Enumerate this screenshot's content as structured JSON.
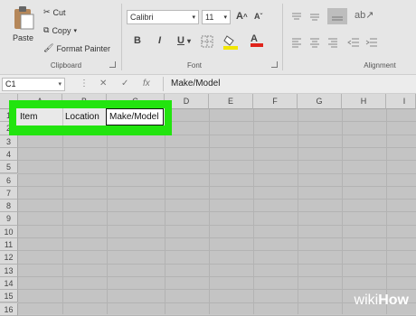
{
  "ribbon": {
    "clipboard": {
      "paste_label": "Paste",
      "cut_label": "Cut",
      "copy_label": "Copy",
      "format_painter_label": "Format Painter",
      "group_label": "Clipboard"
    },
    "font": {
      "font_name": "Calibri",
      "font_size": "11",
      "grow_glyph": "A",
      "shrink_glyph": "A",
      "bold": "B",
      "italic": "I",
      "underline": "U",
      "font_color_glyph": "A",
      "group_label": "Font",
      "highlight_color": "#f2e600",
      "font_color": "#e0241b"
    },
    "alignment": {
      "group_label": "Alignment"
    }
  },
  "formula_bar": {
    "name_box": "C1",
    "cancel_glyph": "✕",
    "enter_glyph": "✓",
    "fx_glyph": "fx",
    "value": "Make/Model"
  },
  "columns": [
    "A",
    "B",
    "C",
    "D",
    "E",
    "F",
    "G",
    "H",
    "I"
  ],
  "rows": [
    "1",
    "2",
    "3",
    "4",
    "5",
    "6",
    "7",
    "8",
    "9",
    "10",
    "11",
    "12",
    "13",
    "14",
    "15",
    "16"
  ],
  "cells": {
    "a1": "Item",
    "b1": "Location",
    "c1": "Make/Model"
  },
  "highlight_color": "#22e40f",
  "watermark": {
    "wiki": "wiki",
    "how": "How"
  }
}
